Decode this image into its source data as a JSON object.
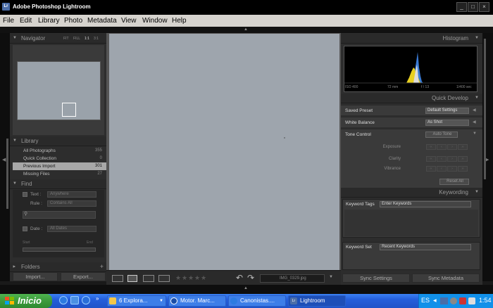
{
  "window": {
    "title": "Adobe Photoshop Lightroom",
    "logo_text": "Lr"
  },
  "menu": [
    "File",
    "Edit",
    "Library",
    "Photo",
    "Metadata",
    "View",
    "Window",
    "Help"
  ],
  "navigator": {
    "title": "Navigator",
    "zoom_options": [
      "FIT",
      "FILL",
      "1:1",
      "3:1"
    ]
  },
  "library": {
    "title": "Library",
    "items": [
      {
        "label": "All Photographs",
        "count": "355"
      },
      {
        "label": "Quick Collection",
        "count": "0"
      },
      {
        "label": "Previous Import",
        "count": "301",
        "selected": true
      },
      {
        "label": "Missing Files",
        "count": "27"
      }
    ]
  },
  "find": {
    "title": "Find",
    "text_label": "Text :",
    "text_value": "Anywhere",
    "rule_label": "Rule :",
    "rule_value": "Contains All",
    "date_label": "Date :",
    "date_value": "All Dates",
    "start_label": "Start",
    "end_label": "End"
  },
  "folders": {
    "title": "Folders",
    "add_symbol": "+"
  },
  "buttons": {
    "import": "Import...",
    "export": "Export...",
    "sync_settings": "Sync Settings",
    "sync_metadata": "Sync Metadata"
  },
  "toolbar": {
    "filename": "IMG_0329.jpg",
    "stars": [
      "★",
      "★",
      "★",
      "★",
      "★"
    ]
  },
  "histogram": {
    "title": "Histogram",
    "iso": "ISO 400",
    "focal": "72 mm",
    "aperture": "f / 13",
    "shutter": "1/400 sec"
  },
  "quick_develop": {
    "title": "Quick Develop",
    "saved_preset_label": "Saved Preset",
    "saved_preset_value": "Default Settings",
    "white_balance_label": "White Balance",
    "white_balance_value": "As Shot",
    "tone_control_label": "Tone Control",
    "auto_tone": "Auto Tone",
    "exposure": "Exposure",
    "clarity": "Clarity",
    "vibrance": "Vibrance",
    "reset_all": "Reset All"
  },
  "keywording": {
    "title": "Keywording",
    "tags_label": "Keyword Tags",
    "tags_value": "Enter Keywords",
    "set_label": "Keyword Set",
    "set_value": "Recent Keywords"
  },
  "taskbar": {
    "start": "Inicio",
    "tasks": [
      "6 Explora...",
      "Motor. Marc...",
      "Canonistas....",
      "Lightroom"
    ],
    "lang": "ES",
    "time": "1:54"
  },
  "colors": {
    "accent_histogram_blue": "#3a7bd5",
    "accent_histogram_yellow": "#e8d020",
    "selected_row": "#a8a8a8"
  }
}
